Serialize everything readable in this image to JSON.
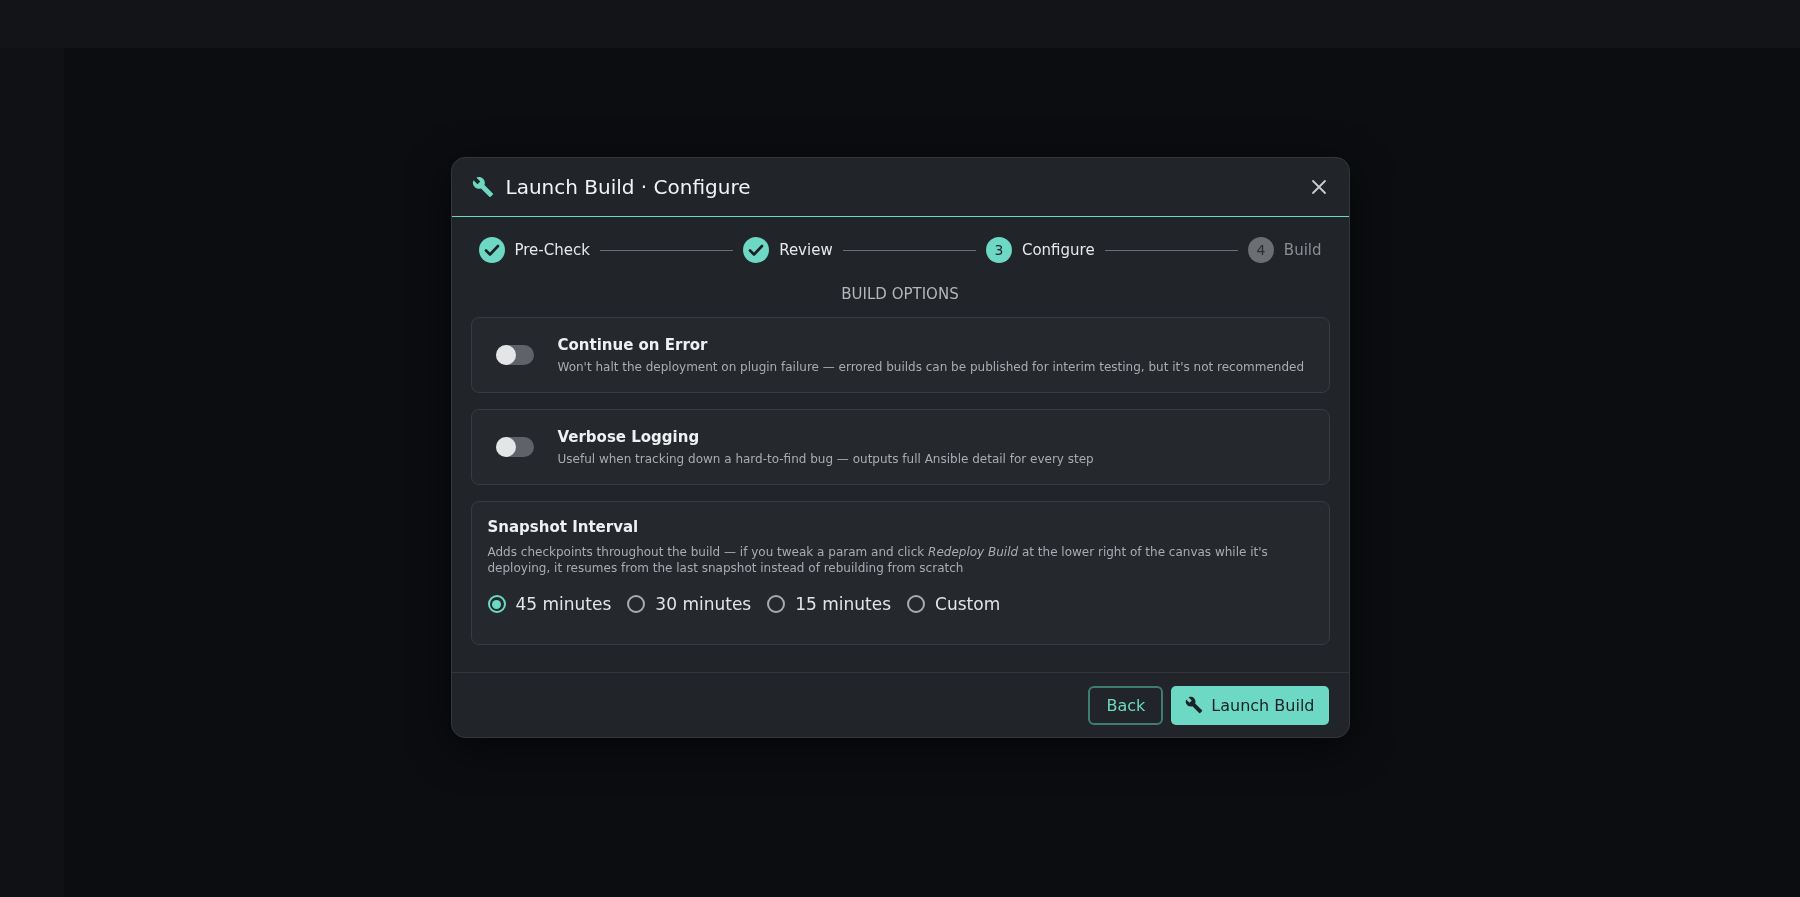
{
  "dialog": {
    "title": "Launch Build · Configure",
    "steps": [
      {
        "label": "Pre-Check",
        "kind": "done"
      },
      {
        "label": "Review",
        "kind": "done"
      },
      {
        "label": "Configure",
        "kind": "current",
        "number": "3"
      },
      {
        "label": "Build",
        "kind": "pending",
        "number": "4"
      }
    ],
    "section_title": "BUILD OPTIONS",
    "toggles": [
      {
        "title": "Continue on Error",
        "description": "Won't halt the deployment on plugin failure — errored builds can be published for interim testing, but it's not recommended",
        "on": false
      },
      {
        "title": "Verbose Logging",
        "description": "Useful when tracking down a hard-to-find bug — outputs full Ansible detail for every step",
        "on": false
      }
    ],
    "snapshot": {
      "title": "Snapshot Interval",
      "description": "Adds checkpoints throughout the build — if you tweak a param and click *Redeploy Build* at the lower right of the canvas while it's deploying, it resumes from the last snapshot instead of rebuilding from scratch",
      "options": [
        {
          "label": "45 minutes",
          "selected": true
        },
        {
          "label": "30 minutes",
          "selected": false
        },
        {
          "label": "15 minutes",
          "selected": false
        },
        {
          "label": "Custom",
          "selected": false
        }
      ]
    },
    "buttons": {
      "back": "Back",
      "launch": "Launch Build"
    }
  }
}
